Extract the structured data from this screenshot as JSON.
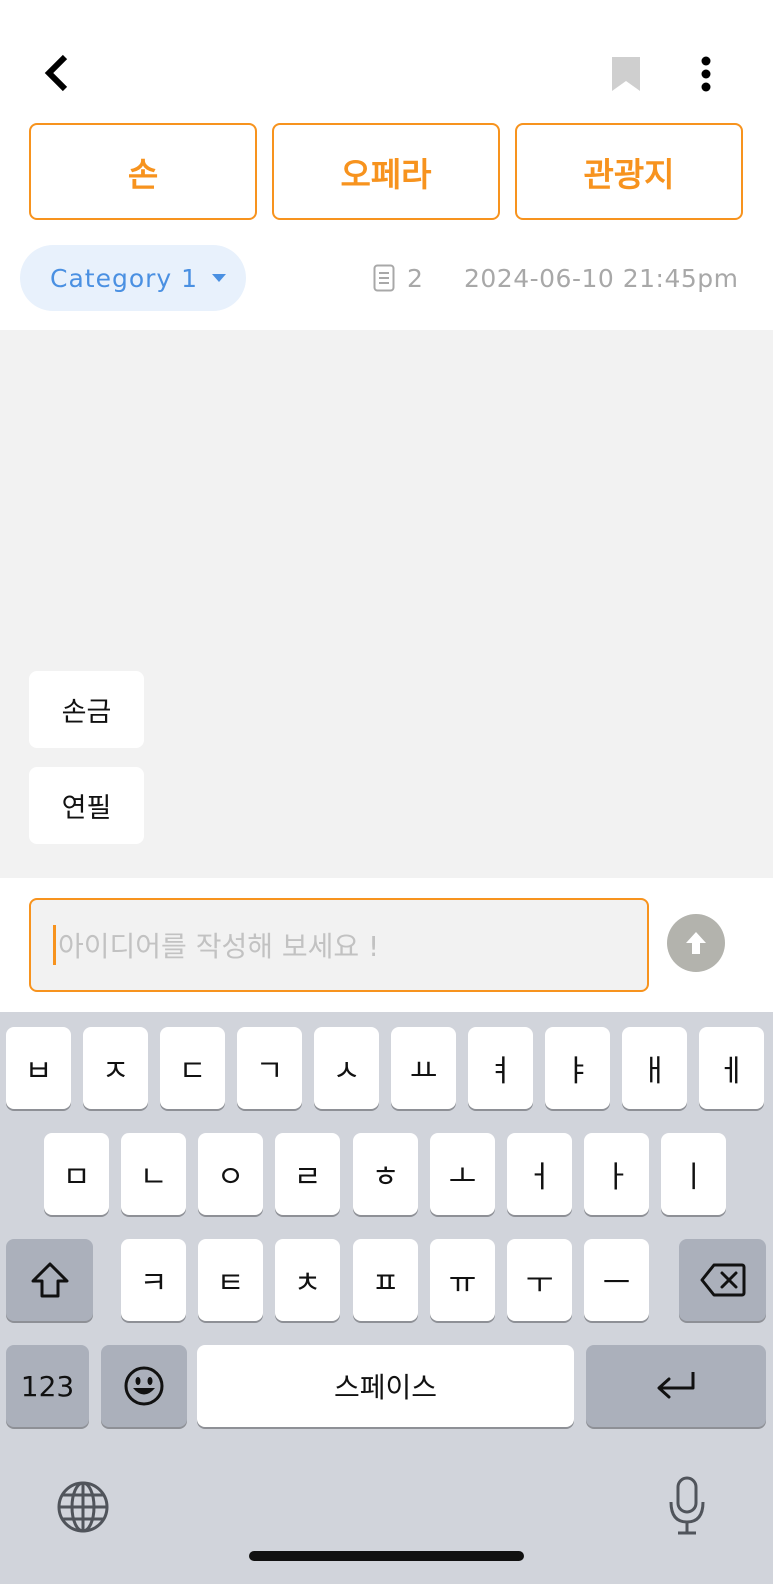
{
  "header": {
    "back_icon": "chevron-left-icon",
    "bookmark_icon": "bookmark-icon",
    "more_icon": "more-vertical-icon"
  },
  "keywords": [
    "손",
    "오페라",
    "관광지"
  ],
  "meta": {
    "category_label": "Category 1",
    "doc_count": "2",
    "timestamp": "2024-06-10 21:45pm"
  },
  "ideas": [
    "손금",
    "연필"
  ],
  "input": {
    "placeholder": "아이디어를 작성해 보세요 !",
    "send_icon": "arrow-up-icon"
  },
  "keyboard": {
    "row1": [
      "ㅂ",
      "ㅈ",
      "ㄷ",
      "ㄱ",
      "ㅅ",
      "ㅛ",
      "ㅕ",
      "ㅑ",
      "ㅐ",
      "ㅔ"
    ],
    "row2": [
      "ㅁ",
      "ㄴ",
      "ㅇ",
      "ㄹ",
      "ㅎ",
      "ㅗ",
      "ㅓ",
      "ㅏ",
      "ㅣ"
    ],
    "row3": [
      "ㅋ",
      "ㅌ",
      "ㅊ",
      "ㅍ",
      "ㅠ",
      "ㅜ",
      "ㅡ"
    ],
    "numbers_label": "123",
    "space_label": "스페이스"
  },
  "colors": {
    "accent": "#f7931e",
    "chip_bg": "#e8f1fc",
    "chip_text": "#4a90e2",
    "idea_bg": "#f2f2f2",
    "keyboard_bg": "#d1d4db"
  }
}
